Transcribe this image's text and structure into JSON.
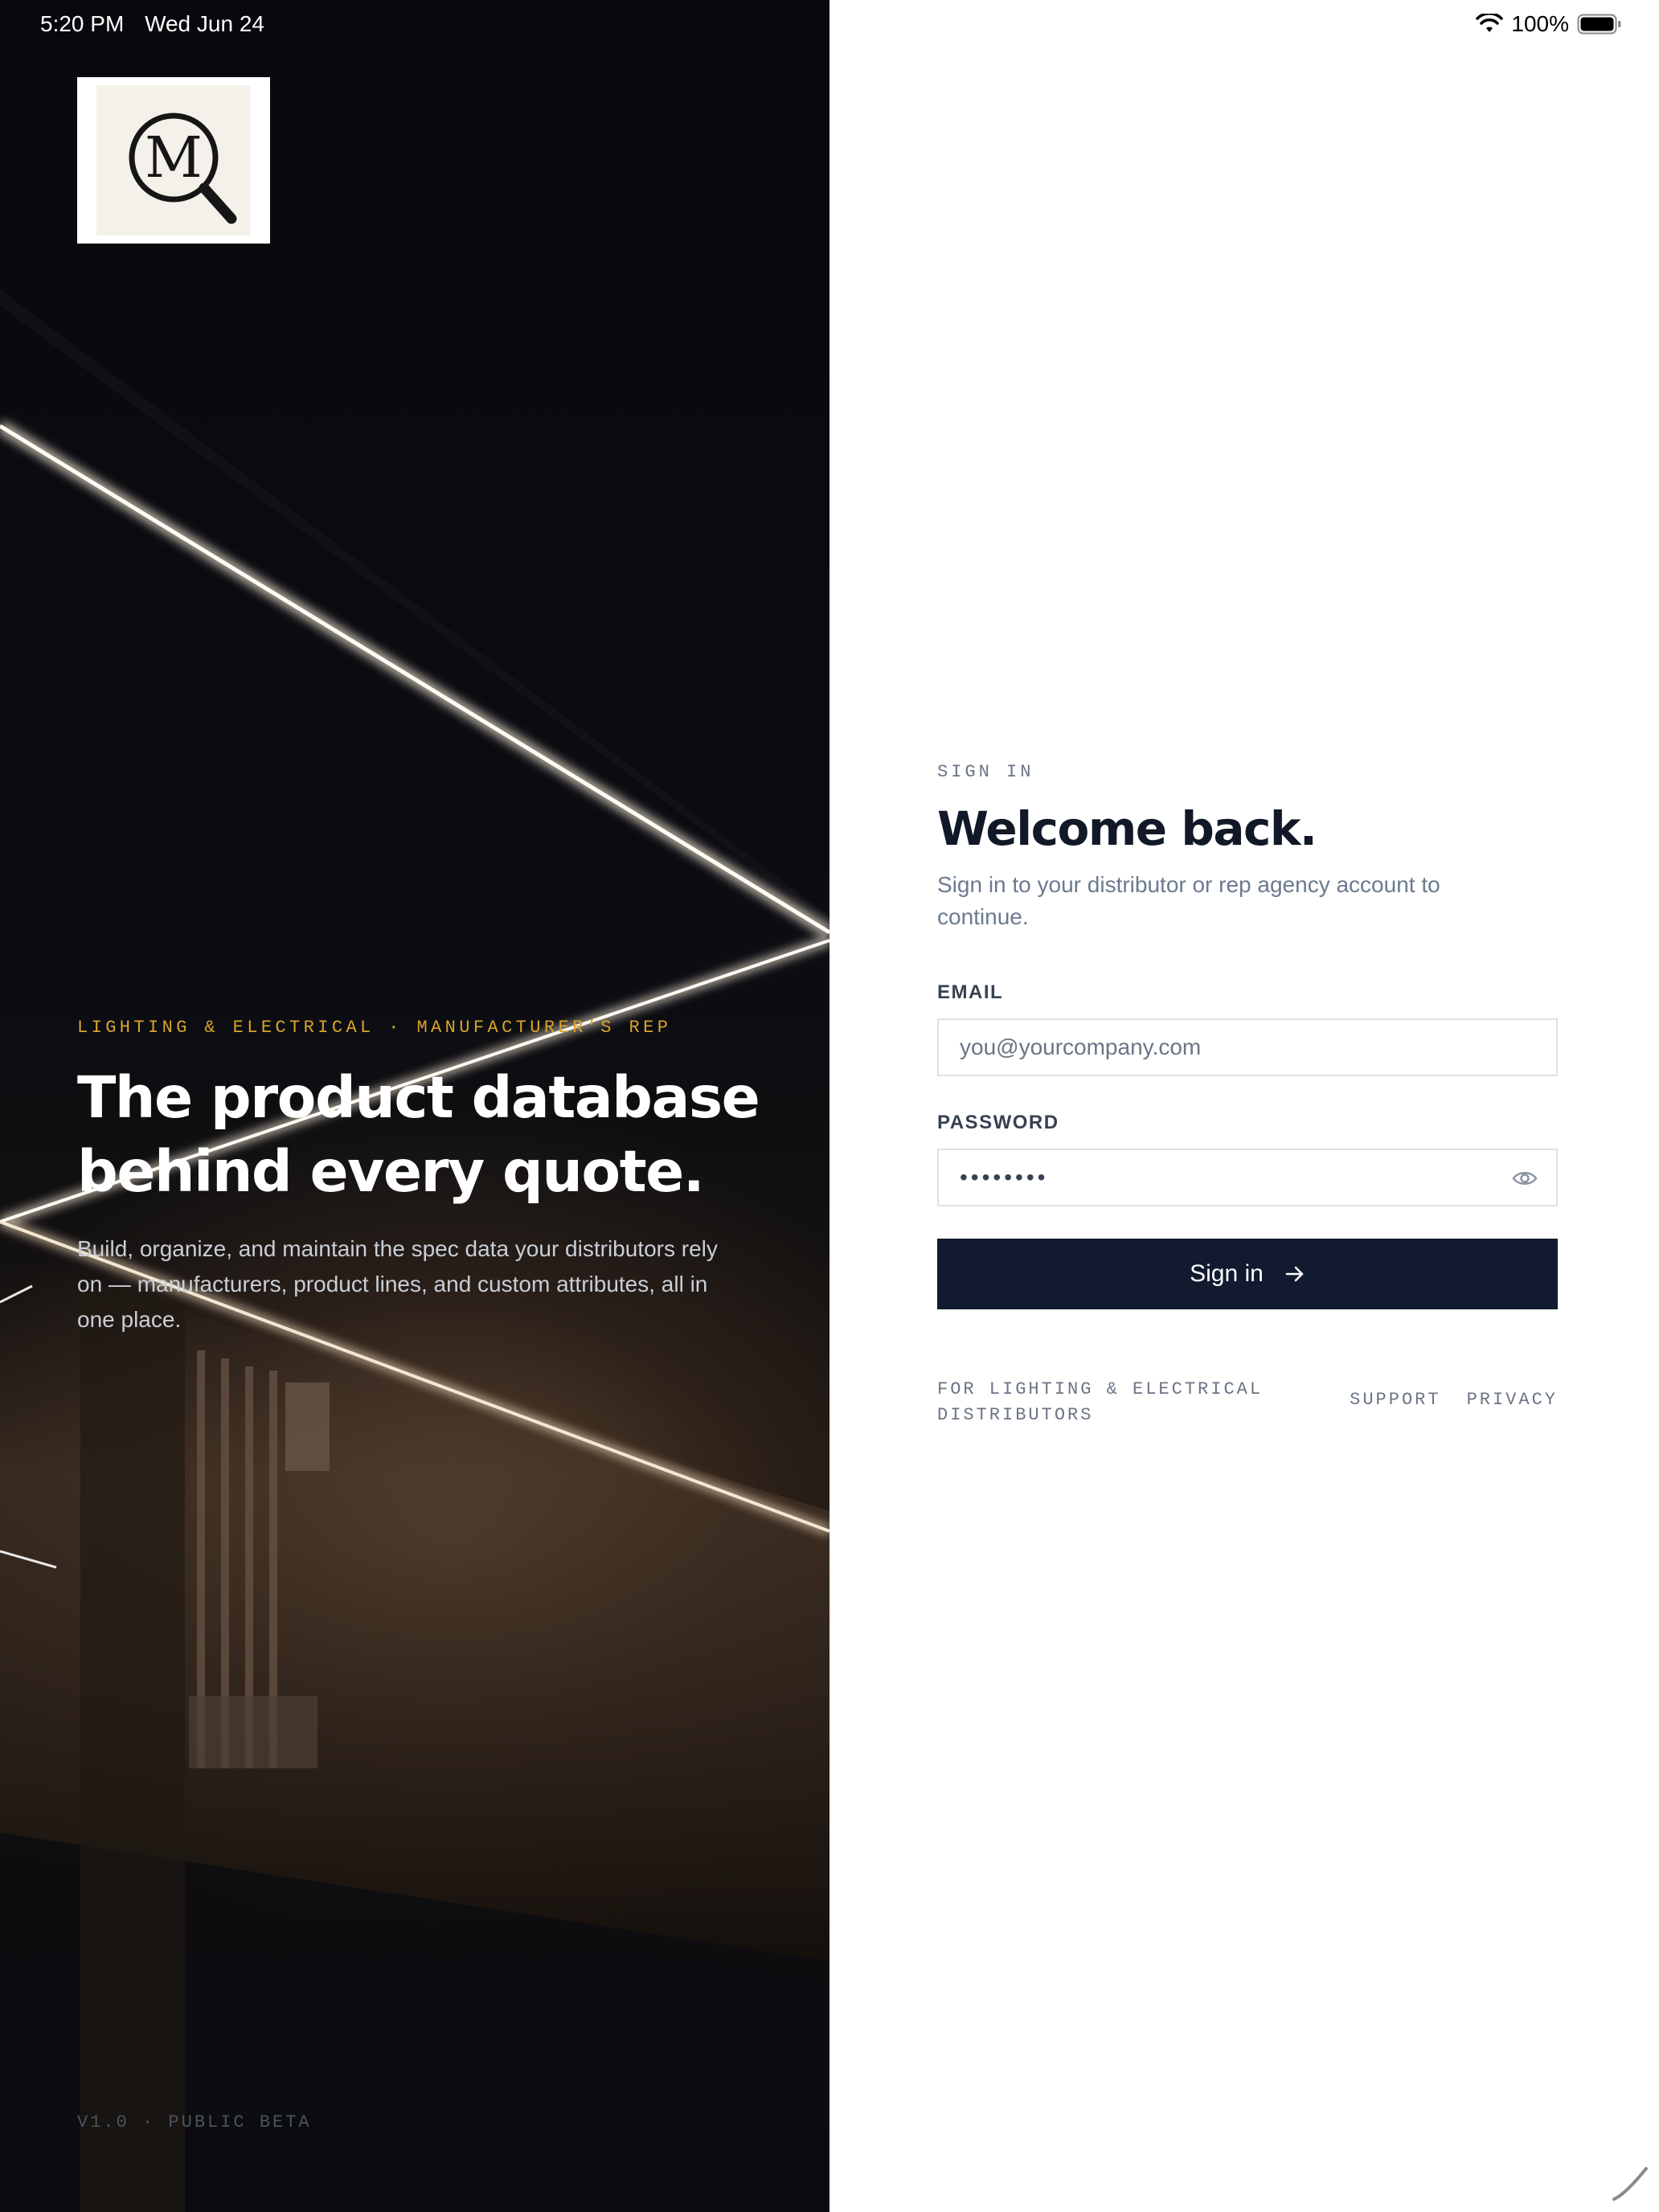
{
  "status_bar": {
    "time": "5:20 PM",
    "date": "Wed Jun 24",
    "battery": "100%",
    "icons": [
      "wifi-icon",
      "battery-icon"
    ]
  },
  "hero": {
    "logo_letter": "M",
    "eyebrow": "LIGHTING & ELECTRICAL · MANUFACTURER'S REP",
    "title_line1": "The product database",
    "title_line2": "behind every quote.",
    "description": "Build, organize, and maintain the spec data your distributors rely on — manufacturers, product lines, and custom attributes, all in one place.",
    "version": "V1.0 · PUBLIC BETA"
  },
  "form": {
    "eyebrow": "SIGN IN",
    "title": "Welcome back.",
    "subtitle": "Sign in to your distributor or rep agency account to continue.",
    "email_label": "EMAIL",
    "email_placeholder": "you@yourcompany.com",
    "email_value": "",
    "password_label": "PASSWORD",
    "password_masked": "••••••••",
    "submit_label": "Sign in",
    "submit_icon": "arrow-right-icon"
  },
  "footer": {
    "tagline": "FOR LIGHTING & ELECTRICAL DISTRIBUTORS",
    "links": [
      "SUPPORT",
      "PRIVACY"
    ]
  },
  "colors": {
    "accent": "#d9a32a",
    "button": "#111a2e",
    "heading": "#111827",
    "muted": "#6b7585"
  }
}
